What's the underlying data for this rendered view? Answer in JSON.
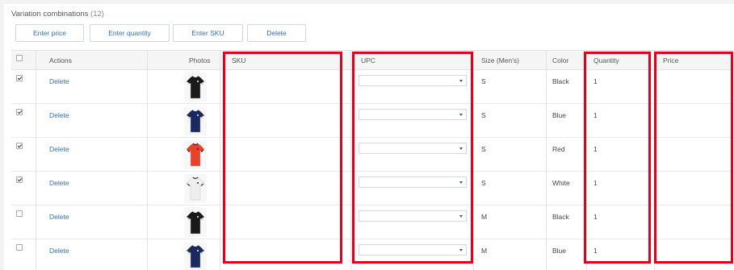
{
  "section": {
    "title": "Variation combinations",
    "count": "(12)"
  },
  "toolbar": {
    "enter_price": "Enter price",
    "enter_quantity": "Enter quantity",
    "enter_sku": "Enter SKU",
    "delete": "Delete"
  },
  "columns": {
    "actions": "Actions",
    "photos": "Photos",
    "sku": "SKU",
    "upc": "UPC",
    "size": "Size (Men's)",
    "color": "Color",
    "quantity": "Quantity",
    "price": "Price"
  },
  "rows": [
    {
      "checked": true,
      "action": "Delete",
      "size": "S",
      "color": "Black",
      "quantity": "1",
      "shirt_color": "#1a1a1a",
      "trim_color": "#ffffff"
    },
    {
      "checked": true,
      "action": "Delete",
      "size": "S",
      "color": "Blue",
      "quantity": "1",
      "shirt_color": "#1b2a5e",
      "trim_color": "#ffffff"
    },
    {
      "checked": true,
      "action": "Delete",
      "size": "S",
      "color": "Red",
      "quantity": "1",
      "shirt_color": "#e8412c",
      "trim_color": "#1a1a1a"
    },
    {
      "checked": true,
      "action": "Delete",
      "size": "S",
      "color": "White",
      "quantity": "1",
      "shirt_color": "#eeeeee",
      "trim_color": "#222222"
    },
    {
      "checked": false,
      "action": "Delete",
      "size": "M",
      "color": "Black",
      "quantity": "1",
      "shirt_color": "#1a1a1a",
      "trim_color": "#ffffff"
    },
    {
      "checked": false,
      "action": "Delete",
      "size": "M",
      "color": "Blue",
      "quantity": "1",
      "shirt_color": "#1b2a5e",
      "trim_color": "#ffffff"
    }
  ],
  "colors": {
    "accent": "#2f6eb5",
    "highlight": "#e2001a"
  }
}
